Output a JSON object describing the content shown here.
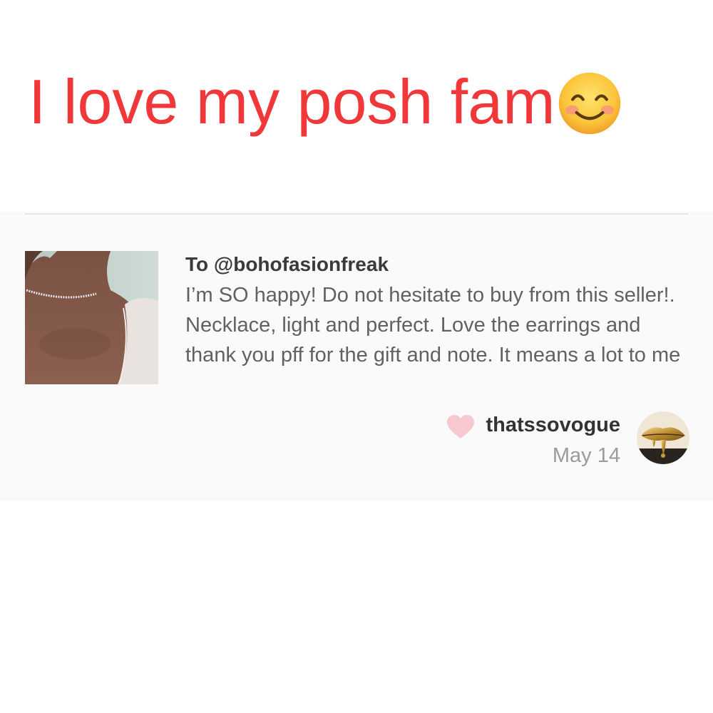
{
  "headline": {
    "text": "I love my posh fam",
    "emoji_icon": "smiling-face-with-smiling-eyes-icon",
    "color": "#f0383b"
  },
  "review": {
    "recipient": "To @bohofasionfreak",
    "comment": "I’m SO happy! Do not hesitate to buy from this seller!. Necklace, light and perfect. Love the earrings and thank you pff for the gift and note. It means a lot to me",
    "product_image": "choker-necklace-photo",
    "heart_icon": "heart-icon",
    "heart_color": "#f7c8d0",
    "author": {
      "username": "thatssovogue",
      "date": "May 14",
      "avatar": "gold-lips-avatar"
    }
  }
}
